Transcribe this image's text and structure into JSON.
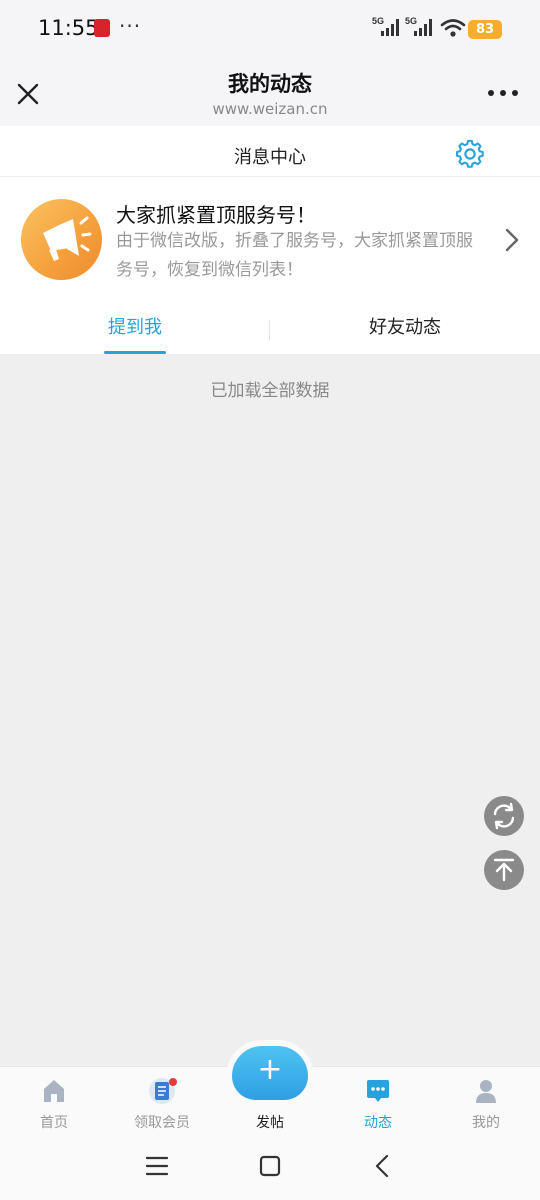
{
  "status_bar": {
    "time": "11:55",
    "more": "···",
    "network_1": "5G",
    "network_2": "5G",
    "battery": "83",
    "battery_color": "#f6ad2b"
  },
  "navbar": {
    "title": "我的动态",
    "subtitle": "www.weizan.cn",
    "close_icon": "close-icon",
    "more_icon": "more-dots-icon"
  },
  "message_center": {
    "title": "消息中心",
    "settings_icon": "gear-icon"
  },
  "notice": {
    "title": "大家抓紧置顶服务号！",
    "body": "由于微信改版，折叠了服务号，大家抓紧置顶服务号，恢复到微信列表！",
    "icon": "megaphone-icon",
    "avatar_color": "#f5a03c"
  },
  "tabs": {
    "items": [
      {
        "label": "提到我",
        "active": true
      },
      {
        "label": "好友动态",
        "active": false
      }
    ],
    "active_color": "#26a3dc"
  },
  "content": {
    "status_text": "已加载全部数据"
  },
  "floating": {
    "refresh_icon": "refresh-icon",
    "top_icon": "back-to-top-icon"
  },
  "tabbar": {
    "items": [
      {
        "label": "首页",
        "icon": "home-icon"
      },
      {
        "label": "领取会员",
        "icon": "document-icon",
        "badge": true
      },
      {
        "label": "发帖",
        "icon": "plus-icon"
      },
      {
        "label": "动态",
        "icon": "chat-bubble-icon",
        "active": true
      },
      {
        "label": "我的",
        "icon": "user-icon"
      }
    ],
    "active_color": "#26a3dc"
  },
  "system_nav": {
    "menu_icon": "menu-icon",
    "home_icon": "square-home-icon",
    "back_icon": "back-icon"
  }
}
